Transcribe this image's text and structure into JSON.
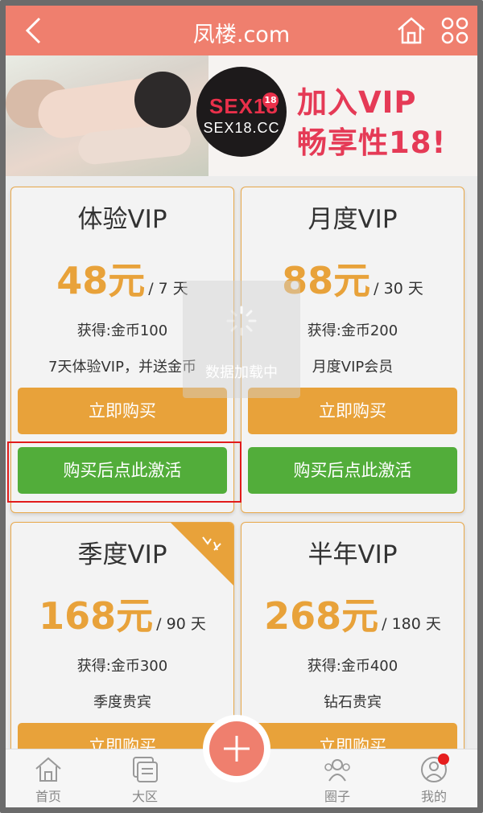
{
  "header": {
    "title": "凤楼.com"
  },
  "banner": {
    "brand_logo": "SEX18",
    "brand_badge": "18",
    "brand_domain": "SEX18.CC",
    "tagline_1": "加入VIP",
    "tagline_2": "畅享性18!"
  },
  "cards": [
    {
      "name": "体验VIP",
      "price": "48元",
      "period": "/ 7 天",
      "coins": "获得:金币100",
      "desc": "7天体验VIP，并送金币",
      "buy_label": "立即购买",
      "activate_label": "购买后点此激活",
      "ribbon": false
    },
    {
      "name": "月度VIP",
      "price": "88元",
      "period": "/ 30 天",
      "coins": "获得:金币200",
      "desc": "月度VIP会员",
      "buy_label": "立即购买",
      "activate_label": "购买后点此激活",
      "ribbon": false
    },
    {
      "name": "季度VIP",
      "price": "168元",
      "period": "/ 90 天",
      "coins": "获得:金币300",
      "desc": "季度贵宾",
      "buy_label": "立即购买",
      "ribbon": true
    },
    {
      "name": "半年VIP",
      "price": "268元",
      "period": "/ 180 天",
      "coins": "获得:金币400",
      "desc": "钻石贵宾",
      "buy_label": "立即购买",
      "ribbon": false
    }
  ],
  "loading": {
    "text": "数据加载中"
  },
  "nav": [
    {
      "label": "首页",
      "icon": "home-icon"
    },
    {
      "label": "大区",
      "icon": "forum-icon"
    },
    {
      "label": "圈子",
      "icon": "group-icon"
    },
    {
      "label": "我的",
      "icon": "profile-icon"
    }
  ],
  "colors": {
    "header": "#ef7f6e",
    "accent": "#e8a23a",
    "activate": "#52ad3a",
    "highlight": "#e11b1b"
  }
}
